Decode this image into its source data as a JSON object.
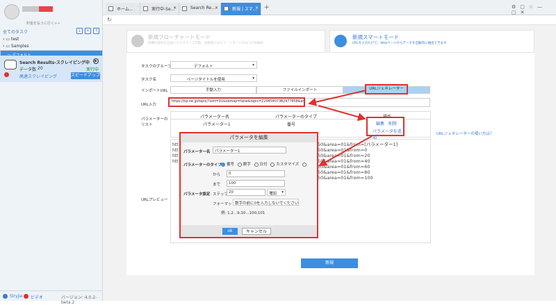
{
  "sidebar": {
    "upgrade_link": "料金を払うに行く>>",
    "all_tasks": "全てのタスク",
    "tree": [
      "test",
      "Samples",
      "デフォルト"
    ],
    "task": {
      "title": "Search Results-スクレイピング中",
      "data_count_label": "データ数",
      "data_count": "20",
      "state": "実行中",
      "mode": "高速スクレイピング",
      "speedup": "スピードアップ"
    },
    "status": {
      "link1": "Slryjie",
      "link2": "ビデオ",
      "version": "バージョン: 4.0.2-beta.2"
    }
  },
  "tabs": [
    {
      "label": "ホーム..."
    },
    {
      "label": "実行中-Se..."
    },
    {
      "label": "Search Re..."
    },
    {
      "label": "新規 | スマ..."
    }
  ],
  "modes": {
    "flowchart": {
      "title": "新規フローチャートモード",
      "desc": "各種の操作を自由にカスタマイズ可能。初級者にはスマートモードのほうがお勧め"
    },
    "smart": {
      "title": "新規スマートモード",
      "desc": "URLを入力だけで、Webページからデータを自動的に抽出できます"
    }
  },
  "form": {
    "group_label": "タスクのグループ",
    "group_value": "デフォルト",
    "name_label": "タスク名",
    "name_value": "ページタイトルを使用",
    "import_label": "インポートURL",
    "import_opts": [
      "手動入力",
      "ファイルインポート",
      "URLジェネレーター"
    ],
    "url_label": "URL入力",
    "url_value": "https://tip.ne.jp/topic/?sort=91&obmap=false&topic=Z29454073B2977858&area=01&from=",
    "param_label": "パラメーターのリスト",
    "table_headers": [
      "パラメーター名",
      "パラメーターのタイプ",
      "操作"
    ],
    "table_row": [
      "パラメーター1",
      "番号"
    ],
    "ops": [
      "編集",
      "削除"
    ],
    "add_param": "パラメータを追加",
    "howto": "URLジェネレーターの使い方は？",
    "preview_label": "URLプレビュー",
    "preview_lines": [
      "50&area=01&from=[パラメーター1]",
      "50&area=01&from=0",
      "50&area=01&from=20",
      "50&area=01&from=40",
      "50&area=01&from=60",
      "50&area=01&from=80",
      "50&area=01&from=100"
    ],
    "preview_prefix": "htt",
    "create_btn": "新規"
  },
  "modal": {
    "title": "パラメータを編集",
    "name_label": "パラメーター名",
    "name_value": "パラメーター1",
    "type_label": "パラメーターのタイプ",
    "types": [
      "番号",
      "数字",
      "日付",
      "カスタマイズ"
    ],
    "from_label": "から",
    "from_value": "0",
    "to_label": "まで",
    "to_value": "100",
    "setting_label": "パラメータ設定",
    "step_label": "ステップ",
    "step_value": "20",
    "inc_value": "増加",
    "format_label": "フォーマット",
    "format_value": "数字の前に0を入力しないでください",
    "example": "例: 1,2...9,10...100,101",
    "ok": "ok",
    "cancel": "キャンセル"
  }
}
